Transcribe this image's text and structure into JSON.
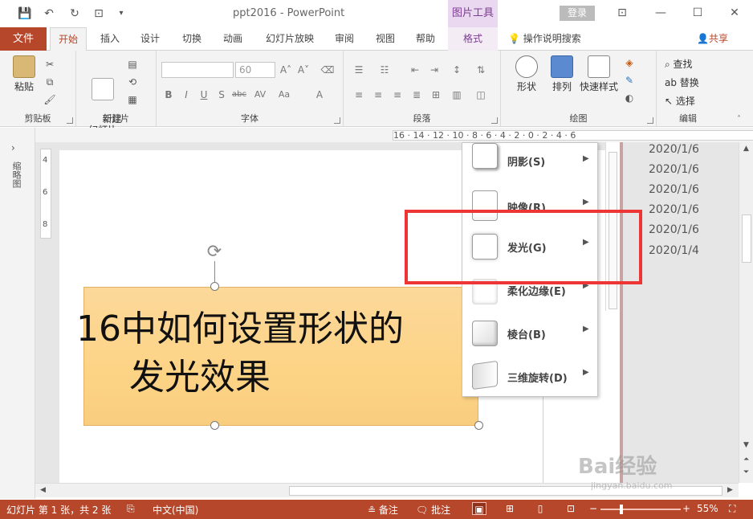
{
  "titlebar": {
    "doc_title": "ppt2016  -  PowerPoint",
    "context_tab_group": "图片工具",
    "login": "登录"
  },
  "tabs": {
    "file": "文件",
    "items": [
      "开始",
      "插入",
      "设计",
      "切换",
      "动画",
      "幻灯片放映",
      "审阅",
      "视图",
      "帮助",
      "格式"
    ],
    "tell_me": "操作说明搜索",
    "share": "共享"
  },
  "ribbon": {
    "clipboard": {
      "paste": "粘贴",
      "label": "剪贴板"
    },
    "slides": {
      "new_slide": "新建\n幻灯片",
      "label": "幻灯片"
    },
    "font": {
      "size": "60",
      "label": "字体"
    },
    "paragraph": {
      "label": "段落"
    },
    "drawing": {
      "shapes": "形状",
      "arrange": "排列",
      "quick_styles": "快速样式",
      "label": "绘图"
    },
    "editing": {
      "find": "查找",
      "replace": "替换",
      "select": "选择",
      "label": "编辑"
    }
  },
  "thumbnail_pane": {
    "label": "缩略图"
  },
  "ruler": {
    "h_ticks": "16 · 14 · 12 · 10 · 8 · 6 · 4 · 2 · 0 · 2 · 4 · 6",
    "v_ticks": [
      "4",
      "6",
      "8"
    ]
  },
  "slide": {
    "line1": "16中如何设置形状的",
    "line2": "发光效果"
  },
  "dates": [
    "2020/1/6",
    "2020/1/6",
    "2020/1/6",
    "2020/1/6",
    "2020/1/6",
    "2020/1/4"
  ],
  "effects_menu": {
    "items": [
      {
        "label": "阴影(S)"
      },
      {
        "label": "映像(R)"
      },
      {
        "label": "发光(G)"
      },
      {
        "label": "柔化边缘(E)"
      },
      {
        "label": "棱台(B)"
      },
      {
        "label": "三维旋转(D)"
      }
    ]
  },
  "statusbar": {
    "slide_info": "幻灯片 第 1 张，共 2 张",
    "language": "中文(中国)",
    "notes": "备注",
    "comments": "批注",
    "zoom": "55%"
  },
  "watermark": {
    "brand": "Bai经验",
    "url": "jingyan.baidu.com"
  },
  "colors": {
    "accent": "#b7472a",
    "context": "#7c3c92",
    "highlight": "#ee3535",
    "shape_fill": "#fdd486"
  }
}
